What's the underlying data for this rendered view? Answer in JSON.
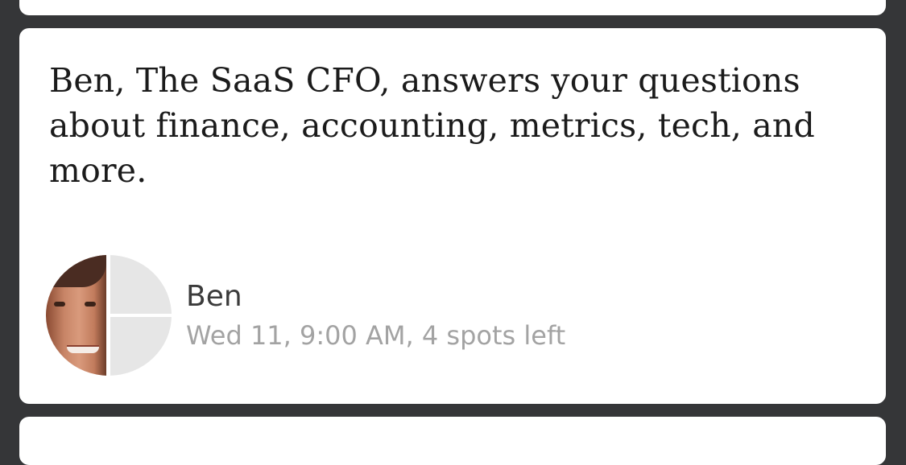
{
  "event": {
    "title": "Ben, The SaaS CFO, answers your questions about finance, accounting, metrics, tech, and more.",
    "host": {
      "name": "Ben"
    },
    "meta": "Wed 11, 9:00 AM, 4 spots left"
  }
}
